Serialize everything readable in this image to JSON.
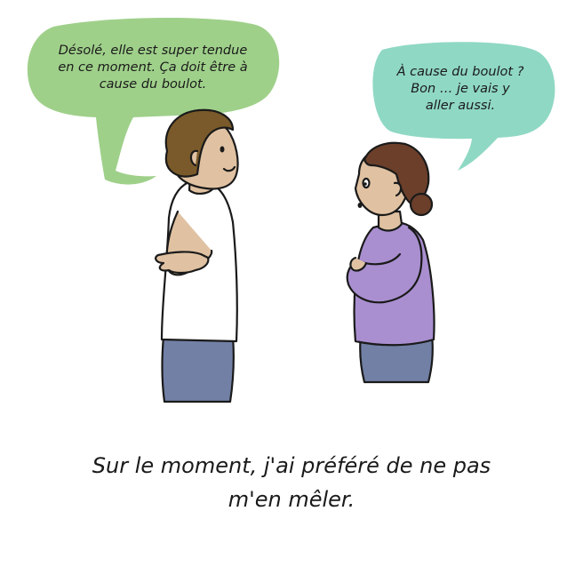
{
  "bubble_man": {
    "lines": [
      "Désolé, elle est super tendue",
      "en ce moment. Ça doit être à",
      "cause du boulot."
    ],
    "color": "#9fd08a"
  },
  "bubble_woman": {
    "lines": [
      "À cause du boulot ?",
      "Bon … je vais y",
      "aller aussi."
    ],
    "color": "#8fd8c4"
  },
  "caption": {
    "lines": [
      "Sur le moment, j'ai préféré de ne pas",
      "m'en mêler."
    ]
  },
  "colors": {
    "skin": "#e0c2a2",
    "man_hair": "#7a5a2a",
    "woman_hair": "#6b3f2a",
    "woman_top": "#a98fd0",
    "trousers": "#7280a6",
    "outline": "#1a1a1a"
  }
}
